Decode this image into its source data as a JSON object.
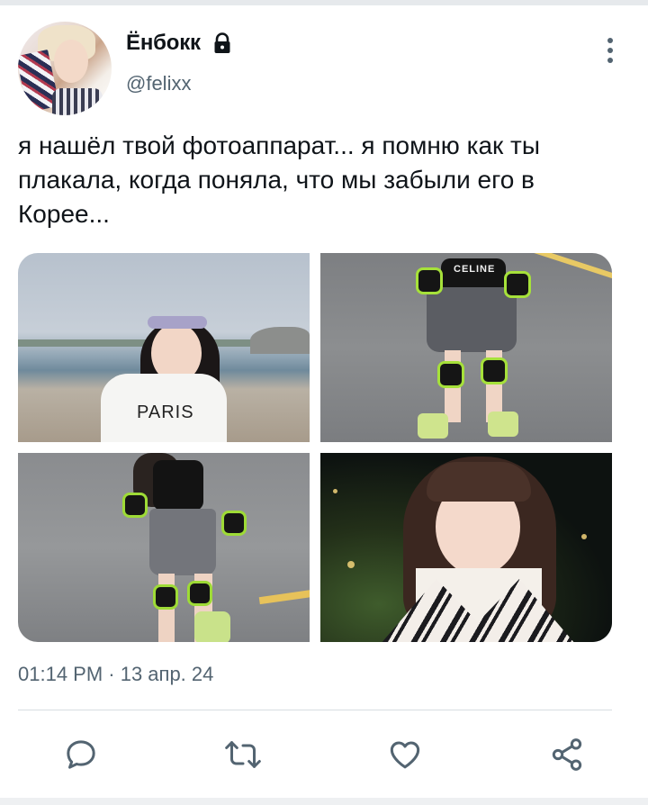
{
  "author": {
    "display_name": "Ёнбокк",
    "handle": "@felixx",
    "protected_icon": "lock-icon",
    "avatar_alt": "profile-photo"
  },
  "tweet": {
    "text": "я нашёл твой фотоаппарат... я помню как ты плакала, когда поняла, что мы забыли его в Корее...",
    "media": [
      {
        "icon": "photo-beach-girl",
        "overlay_text": "PARIS"
      },
      {
        "icon": "photo-skating-girl",
        "overlay_text": "CELINE"
      },
      {
        "icon": "photo-skating-girl-2"
      },
      {
        "icon": "photo-girl-portrait-night"
      }
    ],
    "timestamp": "01:14 PM · 13 апр. 24"
  },
  "actions": [
    {
      "name": "reply",
      "icon": "comment-icon"
    },
    {
      "name": "retweet",
      "icon": "retweet-icon"
    },
    {
      "name": "like",
      "icon": "heart-icon"
    },
    {
      "name": "share",
      "icon": "share-icon"
    }
  ],
  "menu": {
    "icon": "more-vertical-icon"
  },
  "colors": {
    "text_primary": "#0f1419",
    "text_secondary": "#536471",
    "divider": "#d7dde2"
  }
}
